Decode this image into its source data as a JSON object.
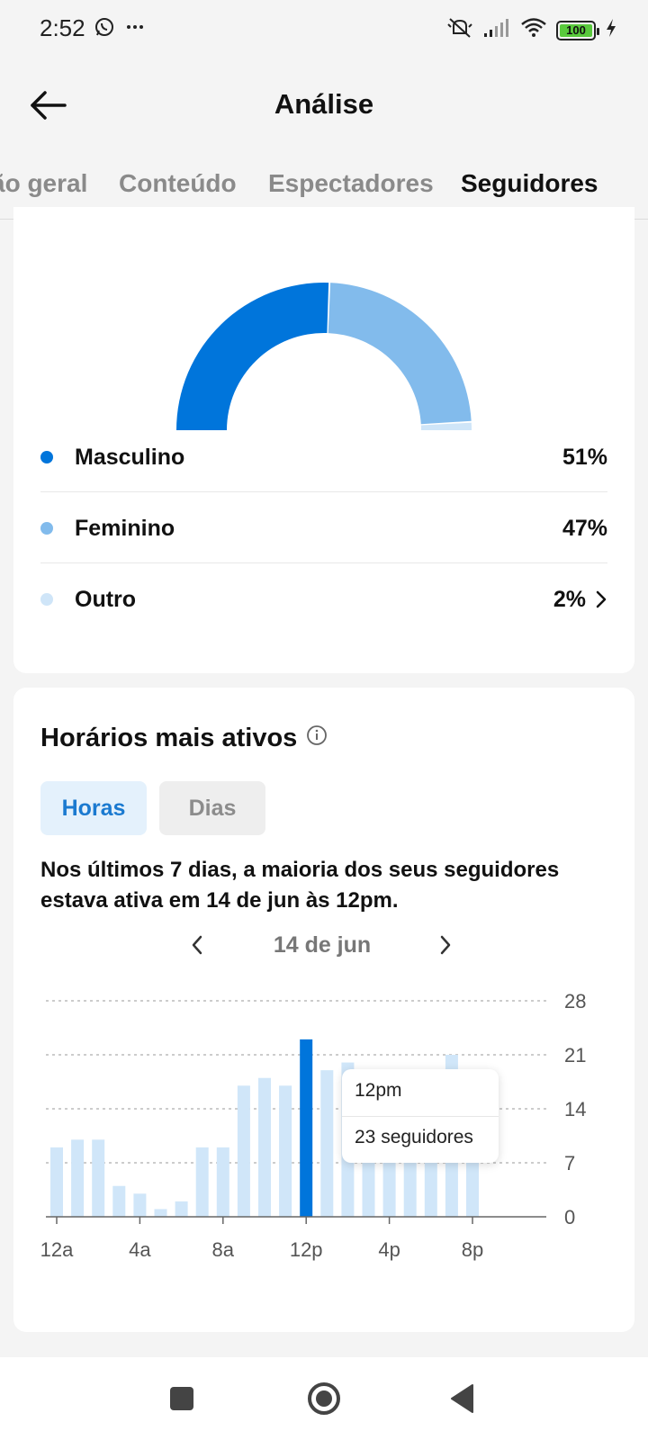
{
  "status_bar": {
    "time": "2:52",
    "battery_level": "100",
    "icons": [
      "whatsapp-icon",
      "more-icon",
      "mute-icon",
      "signal-icon",
      "wifi-icon",
      "battery-icon",
      "charging-icon"
    ]
  },
  "header": {
    "title": "Análise",
    "back_icon": "arrow-left-icon"
  },
  "tabs": [
    {
      "label": "ão geral",
      "active": false
    },
    {
      "label": "Conteúdo",
      "active": false
    },
    {
      "label": "Espectadores",
      "active": false
    },
    {
      "label": "Seguidores",
      "active": true
    }
  ],
  "gender": {
    "colors": {
      "male": "#0075db",
      "female": "#82bbec",
      "other": "#cfe5f8"
    },
    "items": [
      {
        "label": "Masculino",
        "value": "51%",
        "percent": 51
      },
      {
        "label": "Feminino",
        "value": "47%",
        "percent": 47
      },
      {
        "label": "Outro",
        "value": "2%",
        "percent": 2
      }
    ]
  },
  "active_times": {
    "title": "Horários mais ativos",
    "toggle": {
      "hours": "Horas",
      "days": "Dias",
      "selected": "hours"
    },
    "summary": "Nos últimos 7 dias, a maioria dos seus seguidores estava ativa em 14 de jun às 12pm.",
    "date": "14 de jun",
    "tooltip": {
      "time": "12pm",
      "count": "23 seguidores"
    }
  },
  "chart_data": {
    "type": "bar",
    "x": [
      "12a",
      "1a",
      "2a",
      "3a",
      "4a",
      "5a",
      "6a",
      "7a",
      "8a",
      "9a",
      "10a",
      "11a",
      "12p",
      "1p",
      "2p",
      "3p",
      "4p",
      "5p",
      "6p",
      "7p",
      "8p"
    ],
    "x_tick_labels": [
      "12a",
      "4a",
      "8a",
      "12p",
      "4p",
      "8p"
    ],
    "values": [
      9,
      10,
      10,
      4,
      3,
      1,
      2,
      9,
      9,
      17,
      18,
      17,
      23,
      19,
      20,
      17,
      17,
      18,
      19,
      21,
      18
    ],
    "highlight_index": 12,
    "ylim": [
      0,
      28
    ],
    "y_ticks": [
      0,
      7,
      14,
      21,
      28
    ],
    "colors": {
      "bar": "#d0e6f9",
      "highlight": "#0075db"
    },
    "grid": true
  },
  "nav_bar": {
    "icons": [
      "recents-icon",
      "home-icon",
      "back-icon"
    ]
  }
}
